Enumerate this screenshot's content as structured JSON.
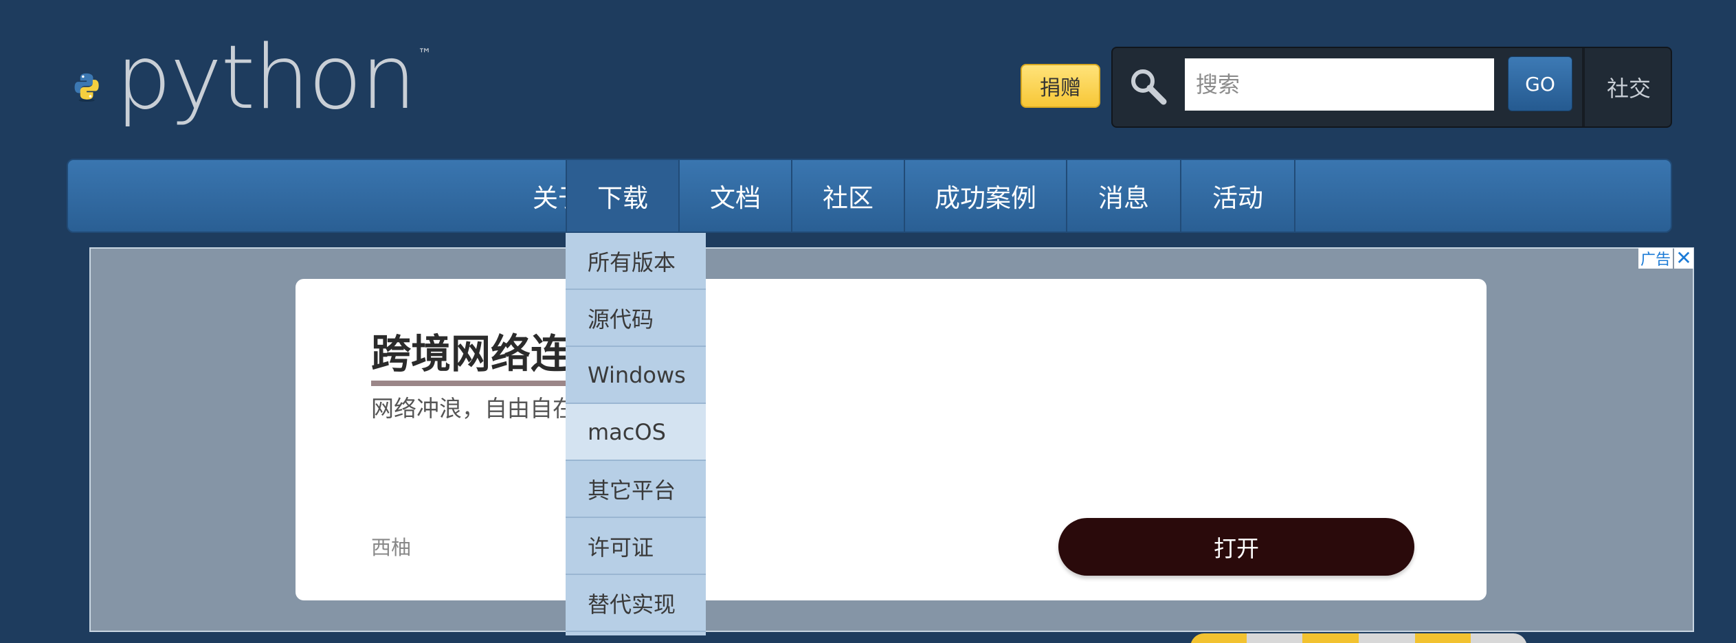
{
  "header": {
    "wordmark": "python",
    "trademark": "™",
    "donate_label": "捐赠",
    "search_placeholder": "搜索",
    "go_label": "GO",
    "social_label": "社交"
  },
  "nav": {
    "items": [
      {
        "label": "关于"
      },
      {
        "label": "下载"
      },
      {
        "label": "文档"
      },
      {
        "label": "社区"
      },
      {
        "label": "成功案例"
      },
      {
        "label": "消息"
      },
      {
        "label": "活动"
      }
    ],
    "active_index": 1
  },
  "dropdown": {
    "items": [
      {
        "label": "所有版本"
      },
      {
        "label": "源代码"
      },
      {
        "label": "Windows"
      },
      {
        "label": "macOS"
      },
      {
        "label": "其它平台"
      },
      {
        "label": "许可证"
      },
      {
        "label": "替代实现"
      }
    ],
    "hover_index": 3
  },
  "ad": {
    "tag": "广告",
    "close_symbol": "✕",
    "title": "跨境网络连",
    "subtitle": "网络冲浪，自由自在",
    "brand": "西柚",
    "open_label": "打开"
  },
  "colors": {
    "background": "#1e3c5e",
    "nav": "#2e659d",
    "donate": "#ffd343",
    "dropdown": "#b7cfe6",
    "ad_button": "#2a0a0b"
  }
}
